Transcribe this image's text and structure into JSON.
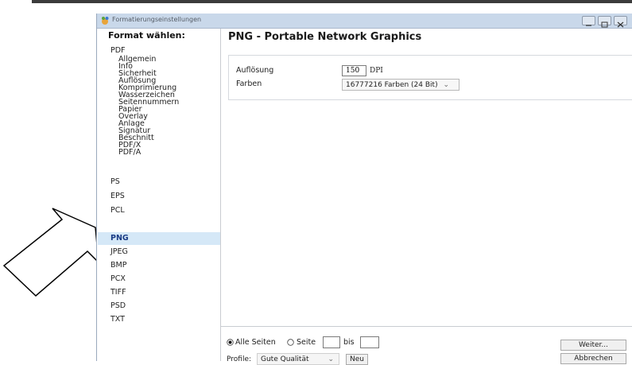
{
  "window": {
    "title": "Formatierungseinstellungen"
  },
  "sidebar": {
    "heading": "Format wählen:",
    "pdf": {
      "label": "PDF",
      "items": [
        "Allgemein",
        "Info",
        "Sicherheit",
        "Auflösung",
        "Komprimierung",
        "Wasserzeichen",
        "Seitennummern",
        "Papier",
        "Overlay",
        "Anlage",
        "Signatur",
        "Beschnitt",
        "PDF/X",
        "PDF/A"
      ]
    },
    "formats": [
      "PS",
      "EPS",
      "PCL",
      "PNG",
      "JPEG",
      "BMP",
      "PCX",
      "TIFF",
      "PSD",
      "TXT"
    ],
    "selected": "PNG"
  },
  "main": {
    "title": "PNG - Portable Network Graphics",
    "resolution": {
      "label": "Auflösung",
      "value": "150",
      "unit": "DPI"
    },
    "colors": {
      "label": "Farben",
      "value": "16777216 Farben (24 Bit)",
      "caret": "⌄"
    }
  },
  "footer": {
    "all_pages": "Alle Seiten",
    "page": "Seite",
    "to": "bis",
    "page_from": "",
    "page_to": "",
    "profile_label": "Profile:",
    "profile_value": "Gute Qualität",
    "profile_caret": "⌄",
    "new_button": "Neu",
    "next_button": "Weiter...",
    "cancel_button": "Abbrechen"
  }
}
